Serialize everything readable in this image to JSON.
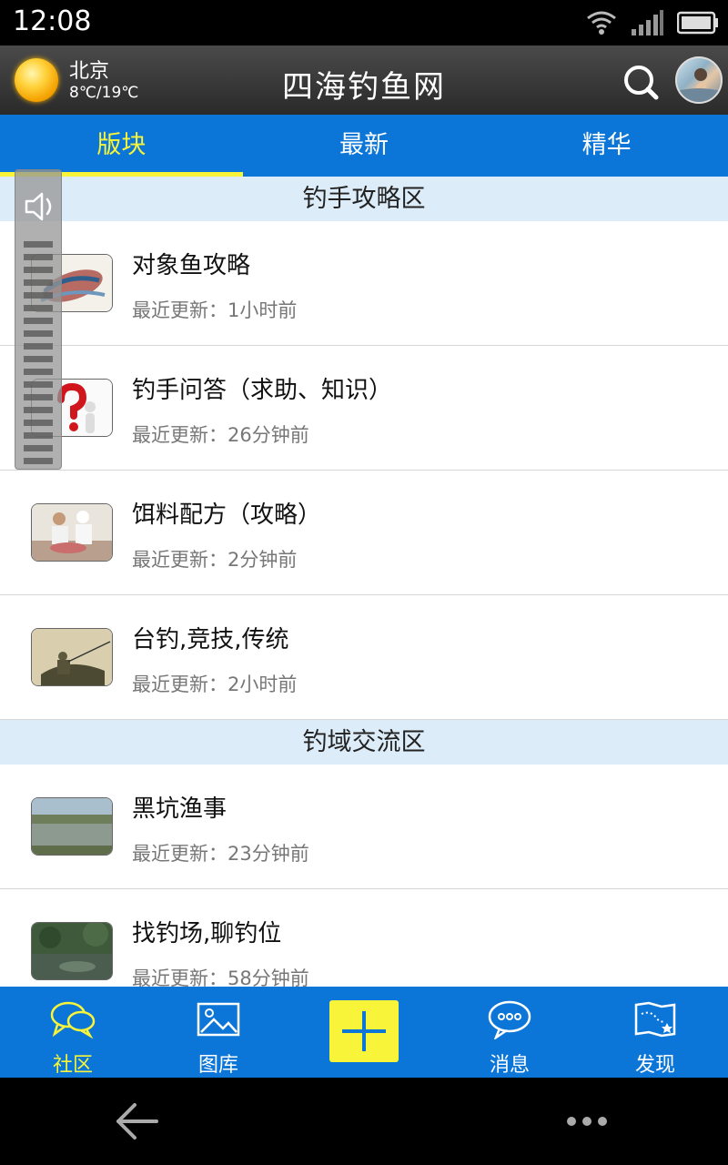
{
  "status_bar": {
    "time": "12:08"
  },
  "header": {
    "weather_city": "北京",
    "weather_temp": "8℃/19℃",
    "title": "四海钓鱼网",
    "icons": [
      "weather-sun-icon",
      "search-icon",
      "avatar"
    ]
  },
  "tabs": [
    {
      "label": "版块",
      "active": true
    },
    {
      "label": "最新",
      "active": false
    },
    {
      "label": "精华",
      "active": false
    }
  ],
  "sections": [
    {
      "title": "钓手攻略区",
      "items": [
        {
          "title": "对象鱼攻略",
          "updated": "最近更新：1小时前"
        },
        {
          "title": "钓手问答（求助、知识）",
          "updated": "最近更新：26分钟前"
        },
        {
          "title": "饵料配方（攻略）",
          "updated": "最近更新：2分钟前"
        },
        {
          "title": "台钓,竞技,传统",
          "updated": "最近更新：2小时前"
        }
      ]
    },
    {
      "title": "钓域交流区",
      "items": [
        {
          "title": "黑坑渔事",
          "updated": "最近更新：23分钟前"
        },
        {
          "title": "找钓场,聊钓位",
          "updated": "最近更新：58分钟前"
        }
      ]
    }
  ],
  "bottom_nav": [
    {
      "label": "社区",
      "icon": "chat-bubbles-icon",
      "active": true
    },
    {
      "label": "图库",
      "icon": "image-icon",
      "active": false
    },
    {
      "label": "消息",
      "icon": "message-icon",
      "active": false
    },
    {
      "label": "发现",
      "icon": "map-icon",
      "active": false
    }
  ],
  "colors": {
    "primary_blue": "#0b76d8",
    "accent_yellow": "#f7f43a",
    "section_bg": "#dcecf8"
  }
}
